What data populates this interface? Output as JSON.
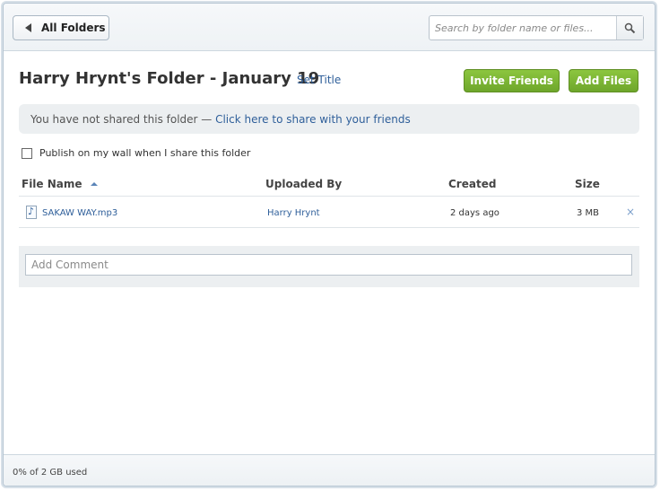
{
  "topbar": {
    "back_label": "All Folders",
    "search_placeholder": "Search by folder name or files..."
  },
  "folder": {
    "title": "Harry Hrynt's Folder - January 19",
    "set_title_label": "Set Title",
    "invite_label": "Invite Friends",
    "add_files_label": "Add Files"
  },
  "share": {
    "message": "You have not shared this folder — ",
    "link_label": "Click here to share with your friends"
  },
  "publish": {
    "label": "Publish on my wall when I share this folder",
    "checked": false
  },
  "table": {
    "headers": {
      "file_name": "File Name",
      "uploaded_by": "Uploaded By",
      "created": "Created",
      "size": "Size"
    },
    "rows": [
      {
        "file_name": "SAKAW WAY.mp3",
        "uploaded_by": "Harry Hrynt",
        "created": "2 days ago",
        "size": "3 MB",
        "remove_icon": "×"
      }
    ]
  },
  "comment": {
    "placeholder": "Add Comment"
  },
  "footer": {
    "usage": "0% of 2 GB used"
  },
  "colors": {
    "accent_green": "#7cb733",
    "link_blue": "#2f5f9a"
  }
}
